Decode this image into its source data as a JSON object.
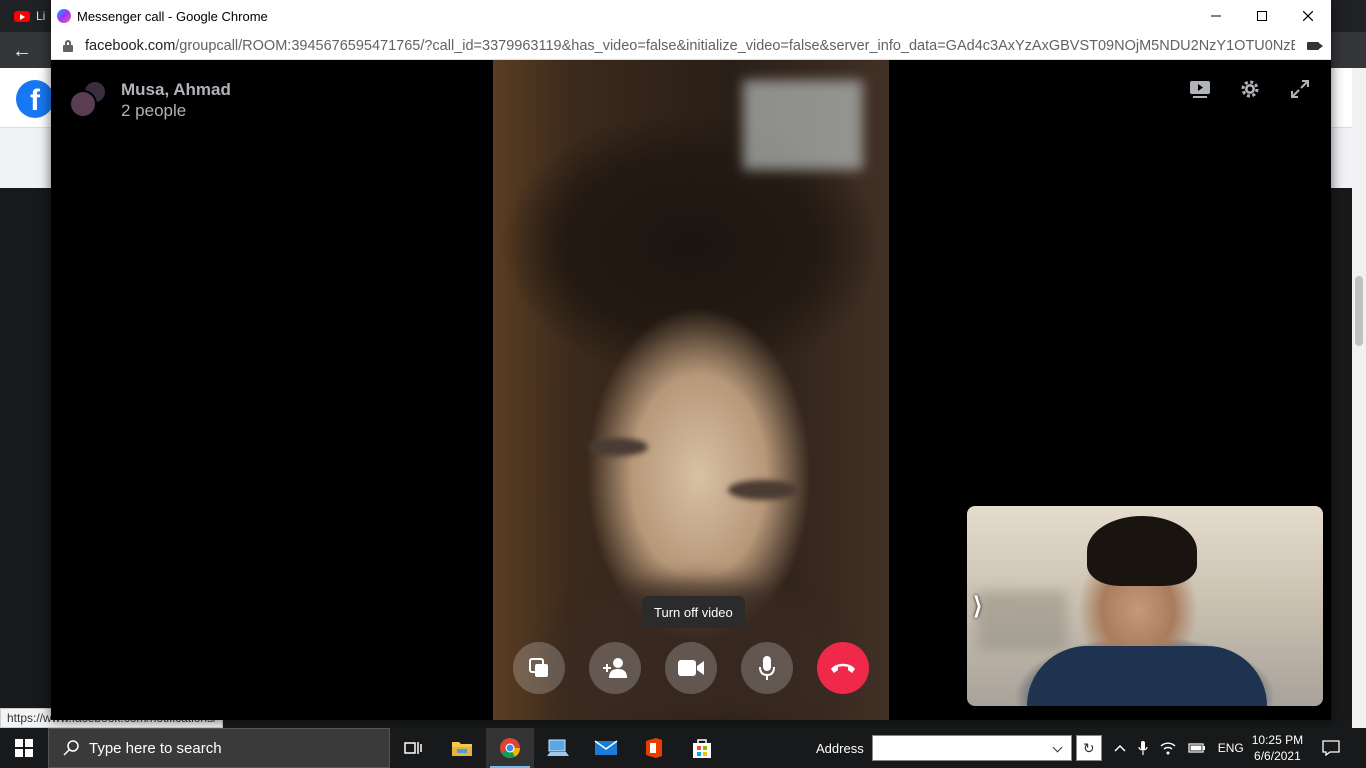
{
  "background_browser": {
    "tab_label": "Li",
    "status_url": "https://www.facebook.com/notifications/"
  },
  "popup": {
    "window_title": "Messenger call - Google Chrome",
    "url_domain": "facebook.com",
    "url_rest": "/groupcall/ROOM:3945676595471765/?call_id=3379963119&has_video=false&initialize_video=false&server_info_data=GAd4c3AxYzAxGBVST09NOjM5NDU2NzY1OTU0NzE3NjUY...",
    "minimize_icon": "minimize-icon",
    "maximize_icon": "maximize-icon",
    "close_icon": "close-icon"
  },
  "call": {
    "participants_names": "Musa, Ahmad",
    "participants_count": "2 people",
    "tooltip": "Turn off video",
    "controls": [
      {
        "name": "share-screen-button",
        "icon": "screen-share-icon"
      },
      {
        "name": "add-people-button",
        "icon": "add-person-icon"
      },
      {
        "name": "video-toggle-button",
        "icon": "video-camera-icon"
      },
      {
        "name": "mute-button",
        "icon": "microphone-icon"
      },
      {
        "name": "end-call-button",
        "icon": "phone-hangup-icon",
        "color": "#f02849"
      }
    ],
    "top_icons": [
      "picture-in-picture-icon",
      "settings-gear-icon",
      "fullscreen-icon"
    ]
  },
  "taskbar": {
    "search_placeholder": "Type here to search",
    "address_label": "Address",
    "language": "ENG",
    "time": "10:25 PM",
    "date": "6/6/2021"
  },
  "colors": {
    "accent_blue": "#1877f2",
    "end_call_red": "#f02849",
    "taskbar": "#18191a"
  }
}
